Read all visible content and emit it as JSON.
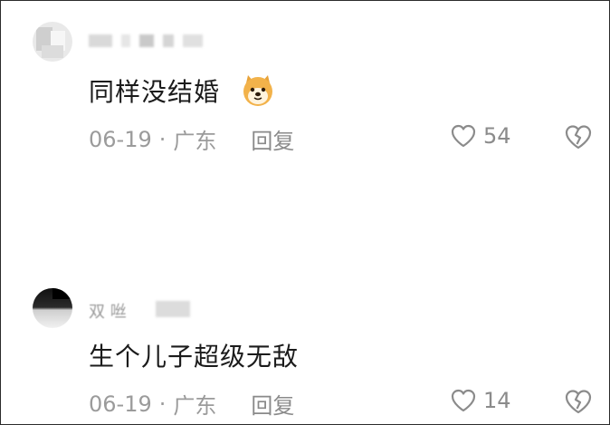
{
  "comments": [
    {
      "text": "同样没结婚",
      "emoji": "doge-emoji",
      "date": "06-19",
      "sep": "·",
      "location": "广东",
      "reply_label": "回复",
      "likes": "54"
    },
    {
      "username_fragment": "双 咝",
      "text": "生个儿子超级无敌",
      "date": "06-19",
      "sep": "·",
      "location": "广东",
      "reply_label": "回复",
      "likes": "14"
    }
  ],
  "icons": {
    "like": "heart-outline-icon",
    "dislike": "broken-heart-icon"
  },
  "colors": {
    "text_main": "#1b1b1b",
    "text_meta": "#9b9b9b",
    "icon": "#8b8b8b"
  }
}
